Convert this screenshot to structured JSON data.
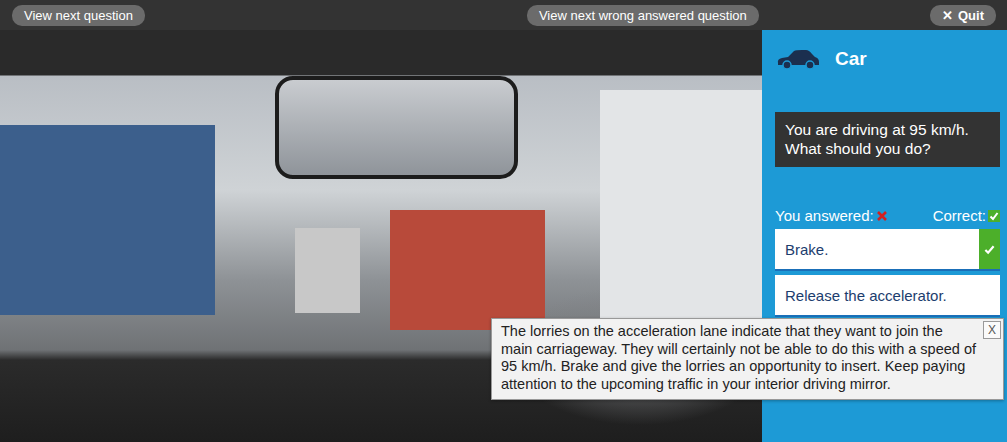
{
  "toolbar": {
    "buttons": [
      {
        "label": "View next question"
      },
      {
        "label": "View next wrong answered question"
      }
    ],
    "quit": {
      "icon": "✕",
      "label": "Quit"
    }
  },
  "panel": {
    "category": "Car",
    "question": "You are driving at 95 km/h. What should you do?",
    "you_answered_label": "You answered:",
    "correct_label": "Correct:",
    "answers": [
      {
        "label": "Brake.",
        "correct": true
      },
      {
        "label": "Release the accelerator.",
        "correct": false
      }
    ]
  },
  "tooltip": {
    "text": "The lorries on the acceleration lane indicate that they want to join the main carriageway. They will certainly not be able to do this with a speed of 95 km/h. Brake and give the lorries an opportunity to insert. Keep paying attention to the upcoming traffic in your interior driving mirror.",
    "close": "X"
  }
}
